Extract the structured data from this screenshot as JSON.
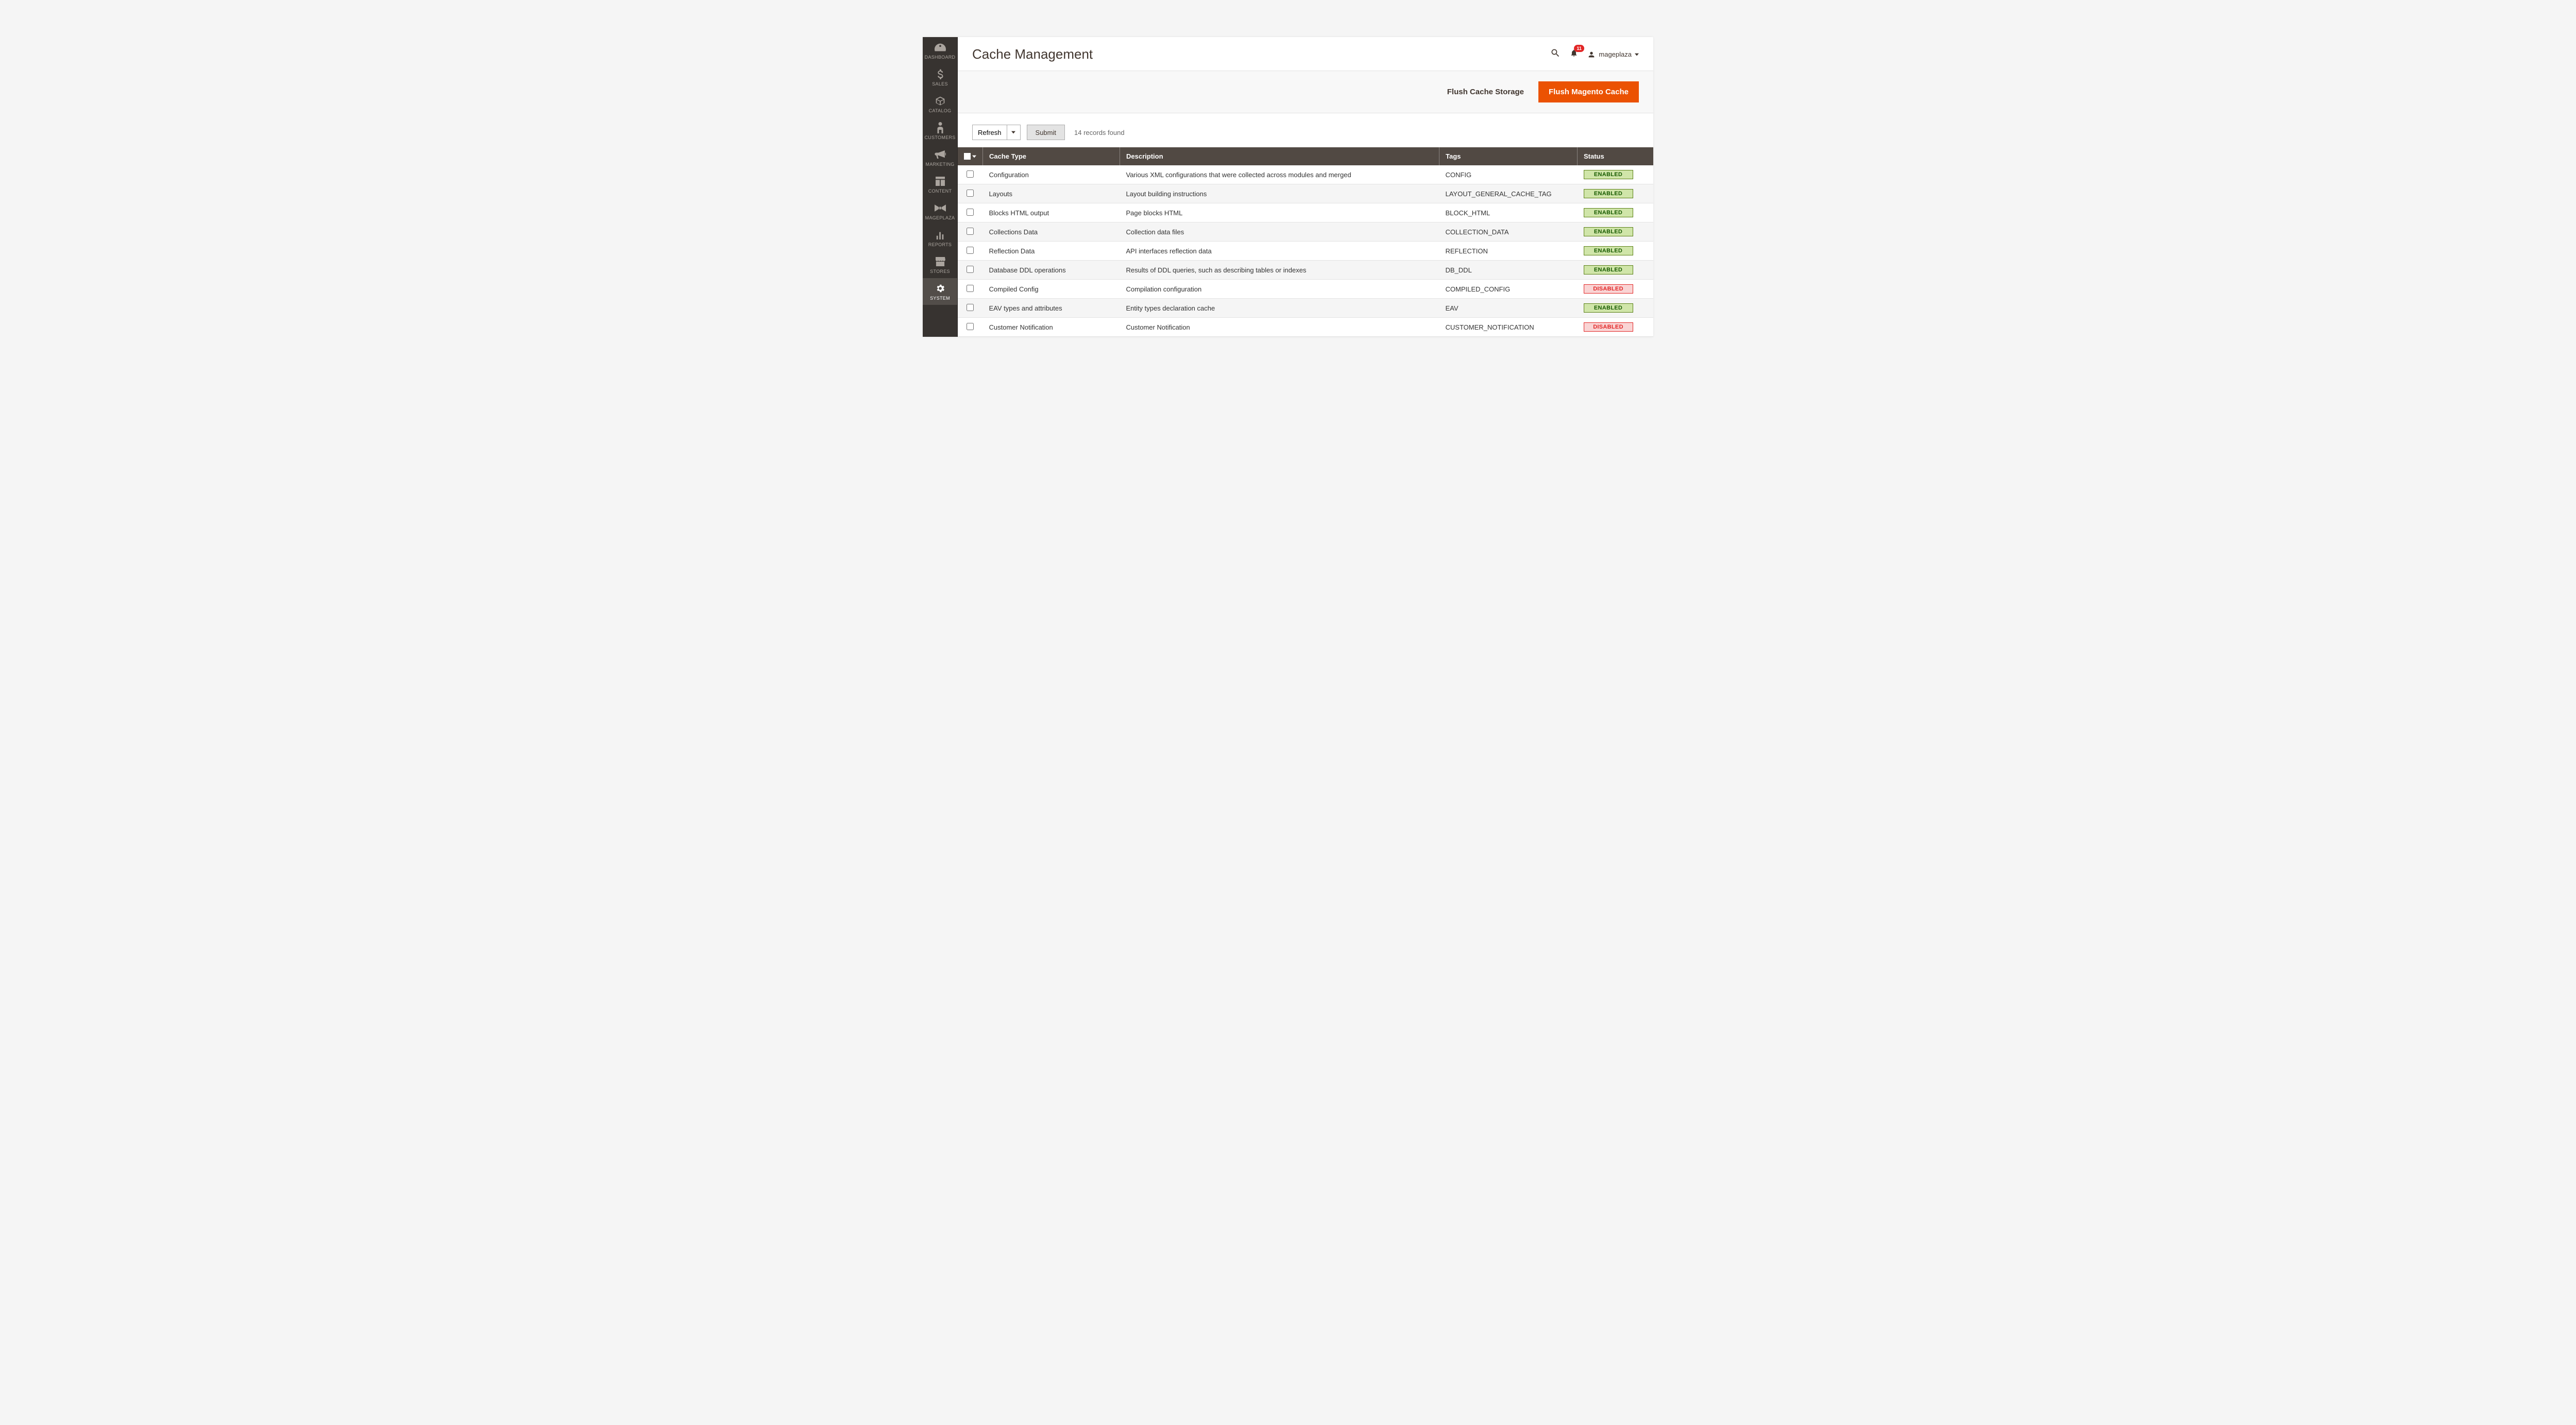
{
  "sidebar": {
    "items": [
      {
        "label": "DASHBOARD",
        "icon": "gauge"
      },
      {
        "label": "SALES",
        "icon": "dollar"
      },
      {
        "label": "CATALOG",
        "icon": "box"
      },
      {
        "label": "CUSTOMERS",
        "icon": "person"
      },
      {
        "label": "MARKETING",
        "icon": "megaphone"
      },
      {
        "label": "CONTENT",
        "icon": "layout"
      },
      {
        "label": "MAGEPLAZA",
        "icon": "bowtie"
      },
      {
        "label": "REPORTS",
        "icon": "bars"
      },
      {
        "label": "STORES",
        "icon": "store"
      },
      {
        "label": "SYSTEM",
        "icon": "gear",
        "active": true
      }
    ]
  },
  "header": {
    "title": "Cache Management",
    "notification_count": "11",
    "username": "mageplaza"
  },
  "actions": {
    "flush_storage": "Flush Cache Storage",
    "flush_magento": "Flush Magento Cache"
  },
  "toolbar": {
    "refresh_label": "Refresh",
    "submit_label": "Submit",
    "records_found": "14 records found"
  },
  "columns": {
    "cache_type": "Cache Type",
    "description": "Description",
    "tags": "Tags",
    "status": "Status"
  },
  "status_labels": {
    "enabled": "ENABLED",
    "disabled": "DISABLED"
  },
  "rows": [
    {
      "type": "Configuration",
      "desc": "Various XML configurations that were collected across modules and merged",
      "tag": "CONFIG",
      "status": "enabled"
    },
    {
      "type": "Layouts",
      "desc": "Layout building instructions",
      "tag": "LAYOUT_GENERAL_CACHE_TAG",
      "status": "enabled"
    },
    {
      "type": "Blocks HTML output",
      "desc": "Page blocks HTML",
      "tag": "BLOCK_HTML",
      "status": "enabled"
    },
    {
      "type": "Collections Data",
      "desc": "Collection data files",
      "tag": "COLLECTION_DATA",
      "status": "enabled"
    },
    {
      "type": "Reflection Data",
      "desc": "API interfaces reflection data",
      "tag": "REFLECTION",
      "status": "enabled"
    },
    {
      "type": "Database DDL operations",
      "desc": "Results of DDL queries, such as describing tables or indexes",
      "tag": "DB_DDL",
      "status": "enabled"
    },
    {
      "type": "Compiled Config",
      "desc": "Compilation configuration",
      "tag": "COMPILED_CONFIG",
      "status": "disabled"
    },
    {
      "type": "EAV types and attributes",
      "desc": "Entity types declaration cache",
      "tag": "EAV",
      "status": "enabled"
    },
    {
      "type": "Customer Notification",
      "desc": "Customer Notification",
      "tag": "CUSTOMER_NOTIFICATION",
      "status": "disabled"
    }
  ]
}
